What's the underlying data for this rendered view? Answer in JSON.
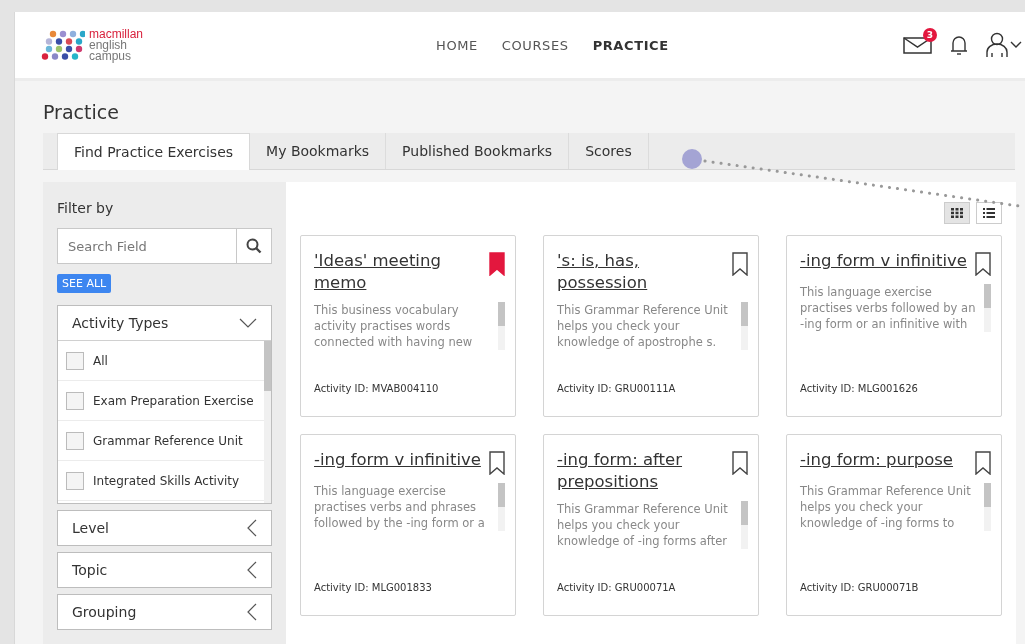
{
  "header": {
    "logo_lines": [
      "macmillan",
      "english",
      "campus"
    ],
    "nav": [
      {
        "label": "HOME",
        "selected": false
      },
      {
        "label": "COURSES",
        "selected": false
      },
      {
        "label": "PRACTICE",
        "selected": true
      }
    ],
    "mail_badge": "3"
  },
  "page_title": "Practice",
  "tabs": [
    {
      "label": "Find Practice Exercises",
      "selected": true
    },
    {
      "label": "My Bookmarks",
      "selected": false
    },
    {
      "label": "Published Bookmarks",
      "selected": false
    },
    {
      "label": "Scores",
      "selected": false
    }
  ],
  "filter": {
    "title": "Filter by",
    "search": {
      "placeholder": "Search Field"
    },
    "see_all": "SEE ALL",
    "sections": [
      {
        "label": "Activity Types",
        "expanded": true,
        "options": [
          {
            "label": "All",
            "checked": false
          },
          {
            "label": "Exam Preparation Exercise",
            "checked": false
          },
          {
            "label": "Grammar Reference Unit",
            "checked": false
          },
          {
            "label": "Integrated Skills Activity",
            "checked": false
          }
        ]
      },
      {
        "label": "Level",
        "expanded": false
      },
      {
        "label": "Topic",
        "expanded": false
      },
      {
        "label": "Grouping",
        "expanded": false
      }
    ]
  },
  "view_modes": [
    {
      "kind": "grid",
      "selected": true
    },
    {
      "kind": "list",
      "selected": false
    }
  ],
  "cards": [
    {
      "title": "'Ideas' meeting memo",
      "bookmarked": true,
      "description": "This business vocabulary activity practises words connected with having new",
      "activity_id": "Activity ID: MVAB004110"
    },
    {
      "title": "'s: is, has, possession",
      "bookmarked": false,
      "description": "This Grammar Reference Unit helps you check your knowledge of apostrophe s.",
      "activity_id": "Activity ID: GRU00111A"
    },
    {
      "title": "-ing form v infinitive",
      "bookmarked": false,
      "description": "This language exercise practises verbs followed by an -ing form or an infinitive with",
      "activity_id": "Activity ID: MLG001626"
    },
    {
      "title": "-ing form v infinitive",
      "bookmarked": false,
      "description": "This language exercise practises verbs and phrases followed by the -ing form or a",
      "activity_id": "Activity ID: MLG001833"
    },
    {
      "title": "-ing form: after prepositions",
      "bookmarked": false,
      "description": "This Grammar Reference Unit helps you check your knowledge of -ing forms after",
      "activity_id": "Activity ID: GRU00071A"
    },
    {
      "title": "-ing form: purpose",
      "bookmarked": false,
      "description": "This Grammar Reference Unit helps you check your knowledge of -ing forms to",
      "activity_id": "Activity ID: GRU00071B"
    }
  ]
}
